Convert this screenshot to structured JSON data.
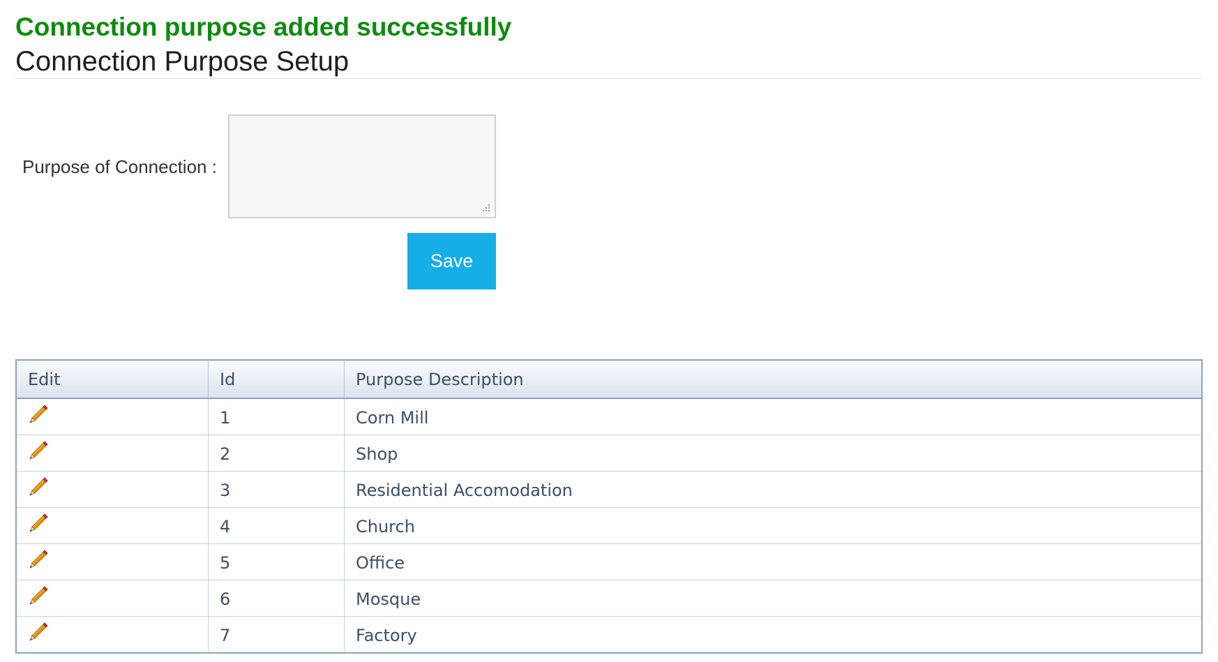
{
  "message": {
    "text": "Connection purpose added successfully",
    "color": "#0f8a0f"
  },
  "page": {
    "title": "Connection Purpose Setup"
  },
  "form": {
    "purpose_label": "Purpose of Connection :",
    "purpose_value": "",
    "save_label": "Save",
    "save_color": "#16aee6"
  },
  "table": {
    "columns": [
      "Edit",
      "Id",
      "Purpose Description"
    ],
    "edit_icon": "pencil-icon",
    "rows": [
      {
        "id": "1",
        "description": "Corn Mill"
      },
      {
        "id": "2",
        "description": "Shop"
      },
      {
        "id": "3",
        "description": "Residential Accomodation"
      },
      {
        "id": "4",
        "description": "Church"
      },
      {
        "id": "5",
        "description": "Office"
      },
      {
        "id": "6",
        "description": "Mosque"
      },
      {
        "id": "7",
        "description": "Factory"
      }
    ]
  }
}
